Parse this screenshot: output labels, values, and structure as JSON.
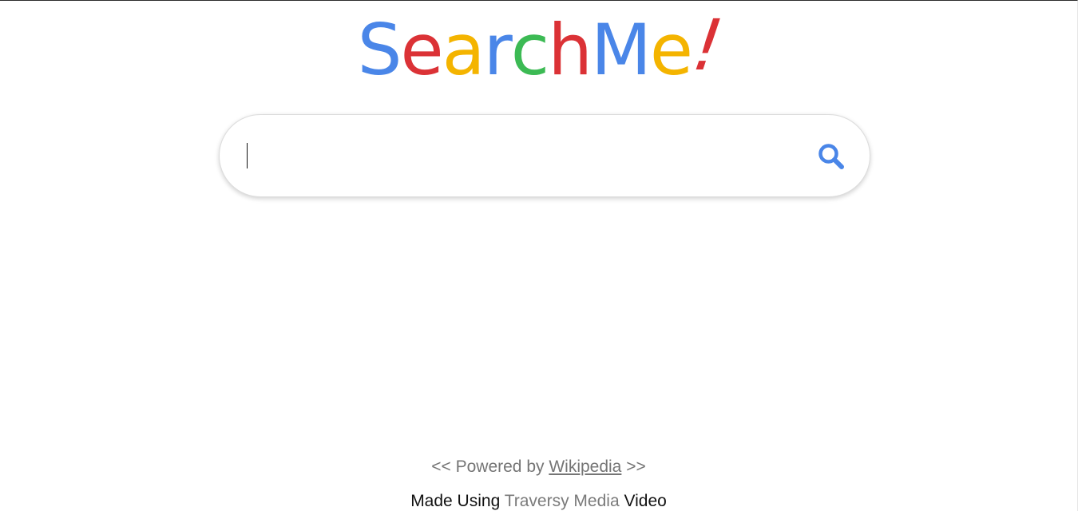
{
  "logo": {
    "letters": [
      {
        "char": "S",
        "color": "#4a86e8"
      },
      {
        "char": "e",
        "color": "#db3236"
      },
      {
        "char": "a",
        "color": "#f4b400"
      },
      {
        "char": "r",
        "color": "#4a86e8"
      },
      {
        "char": "c",
        "color": "#3cba54"
      },
      {
        "char": "h",
        "color": "#db3236"
      },
      {
        "char": "M",
        "color": "#4a86e8"
      },
      {
        "char": "e",
        "color": "#f4b400"
      },
      {
        "char": "!",
        "color": "#db3236"
      }
    ]
  },
  "search": {
    "value": "",
    "placeholder": "",
    "button_icon": "search-icon",
    "accent_color": "#4a86e8"
  },
  "footer": {
    "powered_prefix": "<< Powered by ",
    "powered_link": "Wikipedia",
    "powered_suffix": " >>",
    "made_prefix": "Made Using ",
    "made_link": "Traversy Media",
    "made_suffix": " Video"
  }
}
